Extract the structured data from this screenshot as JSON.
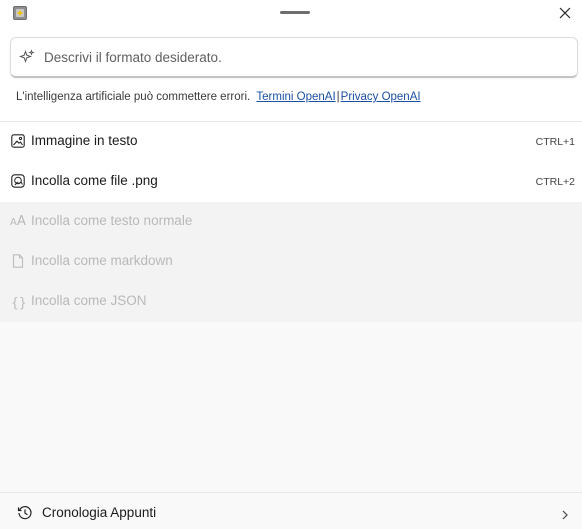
{
  "window": {
    "icon": "app-icon",
    "close_icon": "close-icon"
  },
  "prompt": {
    "placeholder": "Descrivi il formato desiderato.",
    "value": "",
    "icon": "sparkle-icon"
  },
  "disclaimer": {
    "text": "L'intelligenza artificiale può commettere errori.",
    "terms_link": "Termini OpenAI",
    "separator": "|",
    "privacy_link": "Privacy OpenAI"
  },
  "ai_options": [
    {
      "label": "Immagine in testo",
      "shortcut": "CTRL+1",
      "icon": "image-icon",
      "enabled": true
    },
    {
      "label": "Incolla come file .png",
      "shortcut": "CTRL+2",
      "icon": "image-file-icon",
      "enabled": true
    }
  ],
  "paste_options": [
    {
      "label": "Incolla come testo normale",
      "icon": "text-format-icon",
      "enabled": false
    },
    {
      "label": "Incolla come markdown",
      "icon": "document-icon",
      "enabled": false
    },
    {
      "label": "Incolla come JSON",
      "icon": "braces-icon",
      "enabled": false
    }
  ],
  "footer": {
    "history_label": "Cronologia Appunti",
    "icon": "history-icon",
    "chevron": "chevron-right-icon"
  },
  "colors": {
    "link": "#1a4fa3",
    "disabled_text": "#b9b9b9",
    "app_icon_yellow": "#f2c400"
  }
}
